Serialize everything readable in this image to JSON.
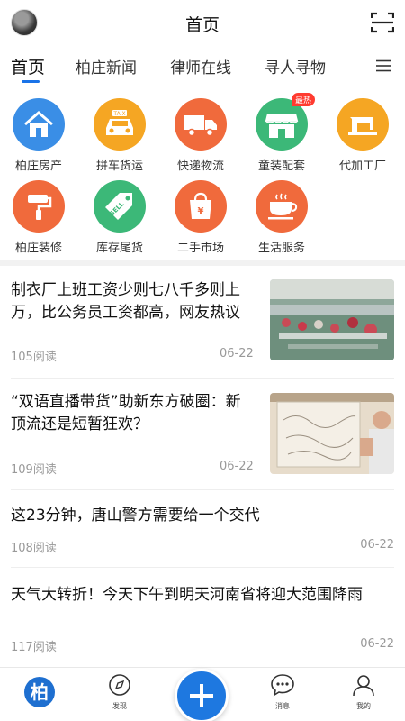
{
  "header": {
    "title": "首页"
  },
  "tabs": [
    "首页",
    "柏庄新闻",
    "律师在线",
    "寻人寻物"
  ],
  "grid": [
    {
      "label": "柏庄房产",
      "icon": "house-icon",
      "color": "#3a8ee6"
    },
    {
      "label": "拼车货运",
      "icon": "taxi-icon",
      "color": "#f5a623",
      "badge_text": "TAIX"
    },
    {
      "label": "快递物流",
      "icon": "truck-icon",
      "color": "#f06a3c"
    },
    {
      "label": "童装配套",
      "icon": "shop-icon",
      "color": "#3cb878",
      "badge": "最热"
    },
    {
      "label": "代加工厂",
      "icon": "sewing-machine-icon",
      "color": "#f5a623"
    },
    {
      "label": "柏庄装修",
      "icon": "paint-roller-icon",
      "color": "#f06a3c"
    },
    {
      "label": "库存尾货",
      "icon": "sell-tag-icon",
      "color": "#3cb878",
      "badge_text": "SELL"
    },
    {
      "label": "二手市场",
      "icon": "shopping-bag-icon",
      "color": "#f06a3c",
      "badge_text": "¥"
    },
    {
      "label": "生活服务",
      "icon": "coffee-cup-icon",
      "color": "#f06a3c"
    }
  ],
  "news": [
    {
      "title": "制衣厂上班工资少则七八千多则上万，比公务员工资都高，网友热议",
      "reads": "105阅读",
      "date": "06-22",
      "has_image": true
    },
    {
      "title": "“双语直播带货”助新东方破圈：新顶流还是短暂狂欢？",
      "reads": "109阅读",
      "date": "06-22",
      "has_image": true
    },
    {
      "title": "这23分钟，唐山警方需要给一个交代",
      "reads": "108阅读",
      "date": "06-22",
      "has_image": false
    },
    {
      "title": "天气大转折！今天下午到明天河南省将迎大范围降雨",
      "reads": "117阅读",
      "date": "06-22",
      "has_image": false
    }
  ],
  "bottom_nav": {
    "home_logo": "柏",
    "discover": "发现",
    "messages": "消息",
    "mine": "我的"
  },
  "colors": {
    "accent": "#1a73e8",
    "fab": "#1e78e0",
    "hot_badge": "#ff3b30"
  }
}
